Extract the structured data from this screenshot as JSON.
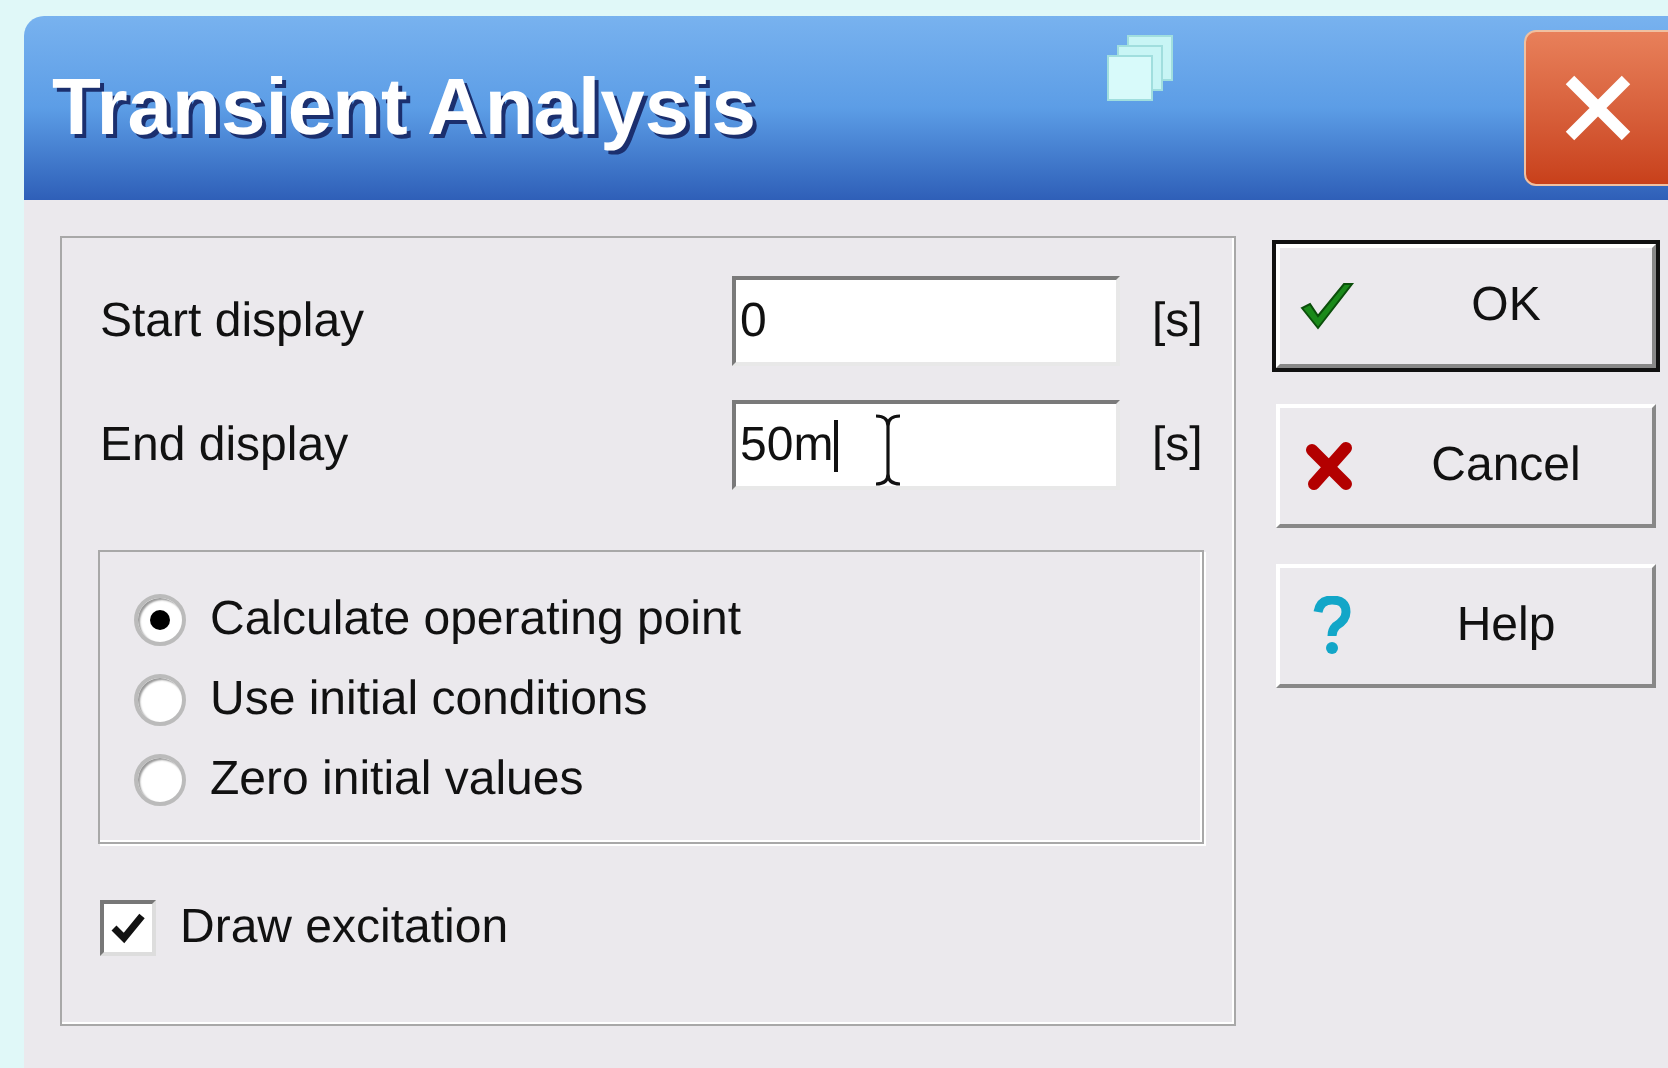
{
  "window": {
    "title": "Transient Analysis"
  },
  "fields": [
    {
      "label": "Start display",
      "value": "0",
      "unit": "[s]",
      "focused": false
    },
    {
      "label": "End display",
      "value": "50m",
      "unit": "[s]",
      "focused": true
    }
  ],
  "options": [
    {
      "label": "Calculate operating point",
      "selected": true
    },
    {
      "label": "Use initial conditions",
      "selected": false
    },
    {
      "label": "Zero initial values",
      "selected": false
    }
  ],
  "checkbox": {
    "label": "Draw excitation",
    "checked": true
  },
  "buttons": [
    {
      "kind": "ok",
      "label": "OK",
      "default": true
    },
    {
      "kind": "cancel",
      "label": "Cancel",
      "default": false
    },
    {
      "kind": "help",
      "label": "Help",
      "default": false
    }
  ]
}
